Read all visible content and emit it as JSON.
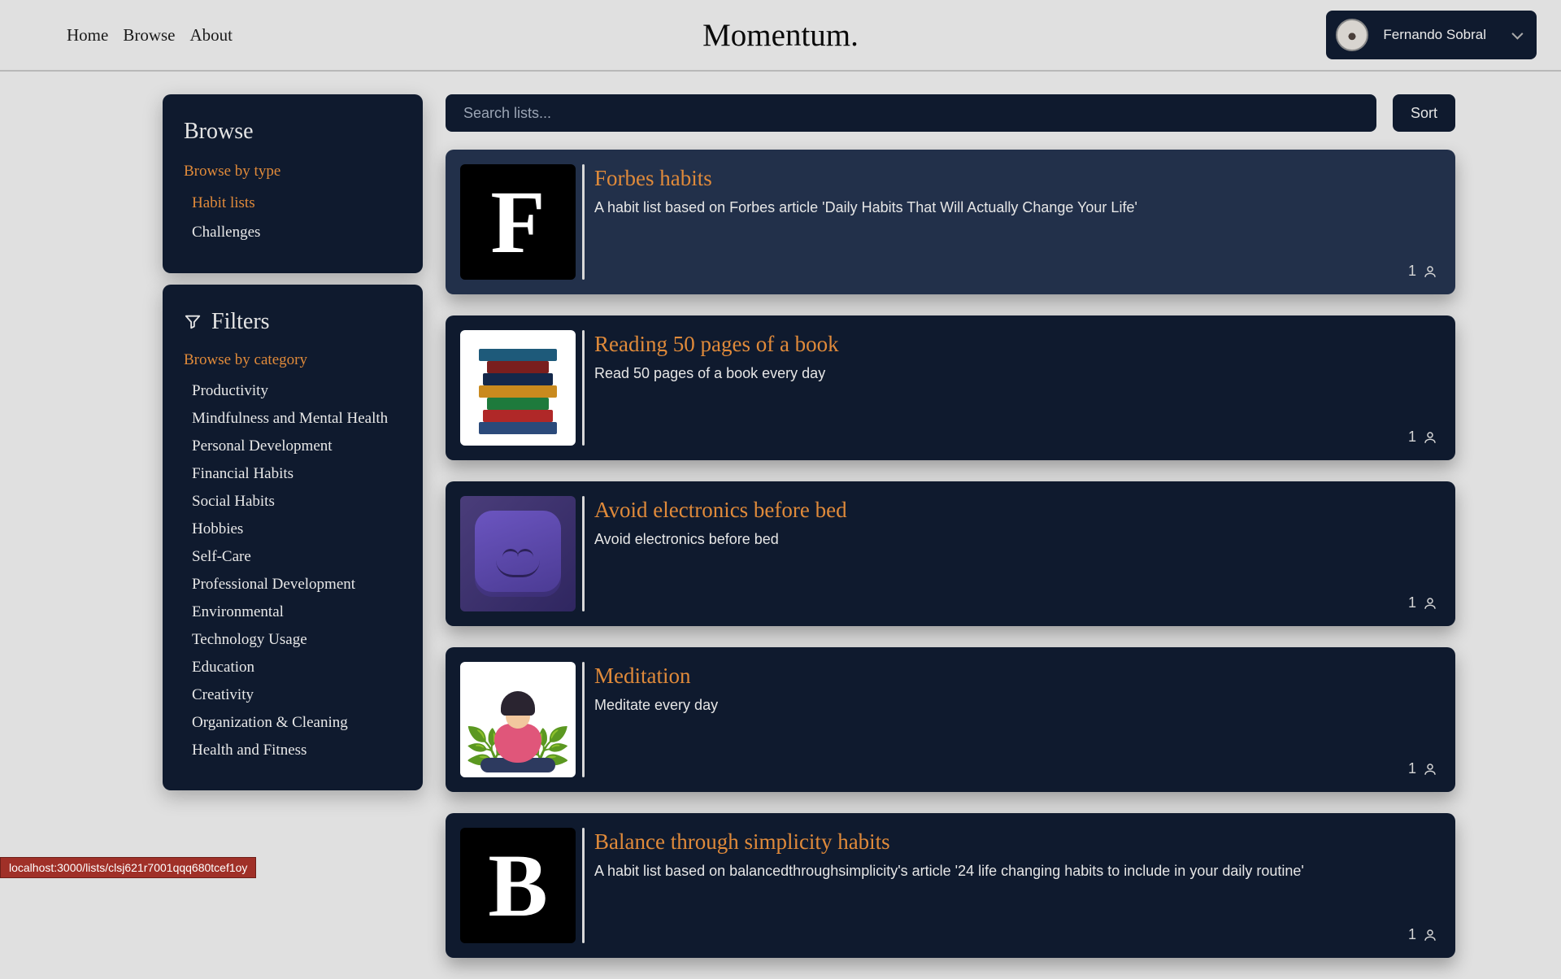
{
  "header": {
    "brand": "Momentum.",
    "nav": {
      "home": "Home",
      "browse": "Browse",
      "about": "About"
    },
    "user_name": "Fernando Sobral"
  },
  "sidebar": {
    "browse_title": "Browse",
    "browse_by_type": "Browse by type",
    "type_items": [
      "Habit lists",
      "Challenges"
    ],
    "type_active_index": 0,
    "filters_title": "Filters",
    "browse_by_category": "Browse by category",
    "categories": [
      "Productivity",
      "Mindfulness and Mental Health",
      "Personal Development",
      "Financial Habits",
      "Social Habits",
      "Hobbies",
      "Self-Care",
      "Professional Development",
      "Environmental",
      "Technology Usage",
      "Education",
      "Creativity",
      "Organization & Cleaning",
      "Health and Fitness"
    ]
  },
  "search": {
    "placeholder": "Search lists..."
  },
  "sort_label": "Sort",
  "cards": [
    {
      "title": "Forbes habits",
      "desc": "A habit list based on Forbes article 'Daily Habits That Will Actually Change Your Life'",
      "count": "1",
      "highlight": true,
      "thumb": {
        "kind": "letter",
        "letter": "F"
      }
    },
    {
      "title": "Reading 50 pages of a book",
      "desc": "Read 50 pages of a book every day",
      "count": "1",
      "highlight": false,
      "thumb": {
        "kind": "books"
      }
    },
    {
      "title": "Avoid electronics before bed",
      "desc": "Avoid electronics before bed",
      "count": "1",
      "highlight": false,
      "thumb": {
        "kind": "pillow"
      }
    },
    {
      "title": "Meditation",
      "desc": "Meditate every day",
      "count": "1",
      "highlight": false,
      "thumb": {
        "kind": "meditation"
      }
    },
    {
      "title": "Balance through simplicity habits",
      "desc": "A habit list based on balancedthroughsimplicity's article '24 life changing habits to include in your daily routine'",
      "count": "1",
      "highlight": false,
      "thumb": {
        "kind": "letter",
        "letter": "B"
      }
    }
  ],
  "status_url": "localhost:3000/lists/clsj621r7001qqq680tcef1oy"
}
